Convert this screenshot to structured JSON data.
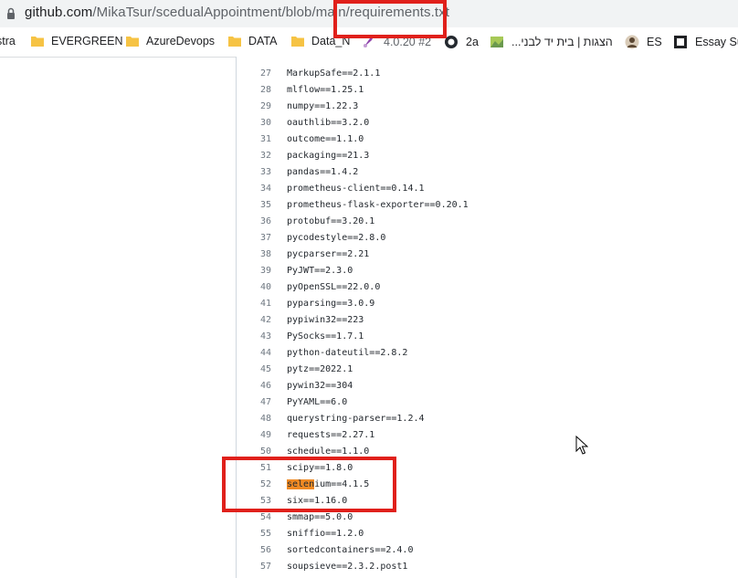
{
  "address_bar": {
    "host": "github.com",
    "path": "/MikaTsur/scedualAppointment/blob/main/requirements.txt",
    "lock_icon": "lock-icon"
  },
  "bookmarks": [
    {
      "label": "stra",
      "icon": "none"
    },
    {
      "label": "EVERGREEN",
      "icon": "folder-icon"
    },
    {
      "label": "AzureDevops",
      "icon": "folder-icon"
    },
    {
      "label": "DATA",
      "icon": "folder-icon"
    },
    {
      "label": "Data_N",
      "icon": "folder-icon"
    },
    {
      "label": "4.0.20 #2",
      "icon": "tools-icon"
    },
    {
      "label": "2a",
      "icon": "github-icon"
    },
    {
      "label": "הצגות | בית יד לבני...",
      "icon": "site-icon"
    },
    {
      "label": "ES",
      "icon": "avatar-icon"
    },
    {
      "label": "Essay Sub",
      "icon": "square-icon"
    }
  ],
  "code_lines": [
    {
      "n": "27",
      "text": "MarkupSafe==2.1.1"
    },
    {
      "n": "28",
      "text": "mlflow==1.25.1"
    },
    {
      "n": "29",
      "text": "numpy==1.22.3"
    },
    {
      "n": "30",
      "text": "oauthlib==3.2.0"
    },
    {
      "n": "31",
      "text": "outcome==1.1.0"
    },
    {
      "n": "32",
      "text": "packaging==21.3"
    },
    {
      "n": "33",
      "text": "pandas==1.4.2"
    },
    {
      "n": "34",
      "text": "prometheus-client==0.14.1"
    },
    {
      "n": "35",
      "text": "prometheus-flask-exporter==0.20.1"
    },
    {
      "n": "36",
      "text": "protobuf==3.20.1"
    },
    {
      "n": "37",
      "text": "pycodestyle==2.8.0"
    },
    {
      "n": "38",
      "text": "pycparser==2.21"
    },
    {
      "n": "39",
      "text": "PyJWT==2.3.0"
    },
    {
      "n": "40",
      "text": "pyOpenSSL==22.0.0"
    },
    {
      "n": "41",
      "text": "pyparsing==3.0.9"
    },
    {
      "n": "42",
      "text": "pypiwin32==223"
    },
    {
      "n": "43",
      "text": "PySocks==1.7.1"
    },
    {
      "n": "44",
      "text": "python-dateutil==2.8.2"
    },
    {
      "n": "45",
      "text": "pytz==2022.1"
    },
    {
      "n": "46",
      "text": "pywin32==304"
    },
    {
      "n": "47",
      "text": "PyYAML==6.0"
    },
    {
      "n": "48",
      "text": "querystring-parser==1.2.4"
    },
    {
      "n": "49",
      "text": "requests==2.27.1"
    },
    {
      "n": "50",
      "text": "schedule==1.1.0"
    },
    {
      "n": "51",
      "text": "scipy==1.8.0"
    },
    {
      "n": "52",
      "text": "selenium==4.1.5",
      "highlight": "selen"
    },
    {
      "n": "53",
      "text": "six==1.16.0"
    },
    {
      "n": "54",
      "text": "smmap==5.0.0"
    },
    {
      "n": "55",
      "text": "sniffio==1.2.0"
    },
    {
      "n": "56",
      "text": "sortedcontainers==2.4.0"
    },
    {
      "n": "57",
      "text": "soupsieve==2.3.2.post1"
    }
  ],
  "colors": {
    "annotation_red": "#e0201b",
    "search_highlight": "#f08a24"
  }
}
